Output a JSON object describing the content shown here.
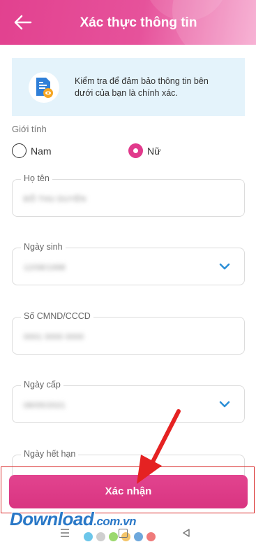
{
  "header": {
    "title": "Xác thực thông tin"
  },
  "info": {
    "text": "Kiểm tra để đảm bảo thông tin bên dưới của bạn là chính xác."
  },
  "gender": {
    "label": "Giới tính",
    "options": [
      "Nam",
      "Nữ"
    ],
    "selected": "Nữ"
  },
  "fields": [
    {
      "label": "Họ tên",
      "value": "ĐỖ THU DUYÊN",
      "dropdown": false
    },
    {
      "label": "Ngày sinh",
      "value": "12/08/1998",
      "dropdown": true
    },
    {
      "label": "Số CMND/CCCD",
      "value": "0001 0000 0000",
      "dropdown": false
    },
    {
      "label": "Ngày cấp",
      "value": "08/05/2021",
      "dropdown": true
    },
    {
      "label": "Ngày hết hạn",
      "value": "",
      "dropdown": false
    }
  ],
  "submit": {
    "label": "Xác nhận"
  },
  "watermark": {
    "text": "Download",
    "domain": ".com.vn"
  },
  "colors": {
    "brand": "#e13a8c",
    "info_bg": "#e4f3fb",
    "accent_blue": "#2a8ed6",
    "highlight": "#d92b2b"
  },
  "icons": {
    "back": "arrow-left-icon",
    "info": "document-verify-icon",
    "chevron": "chevron-down-icon"
  }
}
